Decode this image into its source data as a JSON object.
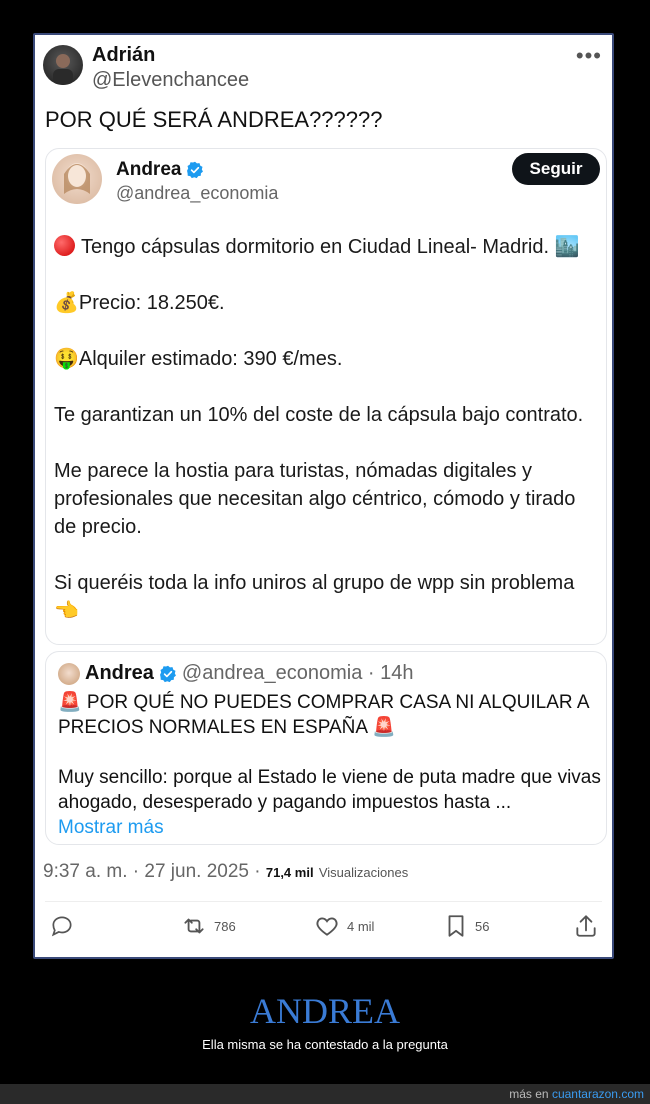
{
  "post": {
    "author_name": "Adrián",
    "author_handle": "@Elevenchancee",
    "more": "•••",
    "text": "POR QUÉ SERÁ ANDREA??????",
    "timestamp": "9:37 a. m. · 27 jun. 2025 ·",
    "views_count": "71,4 mil",
    "views_label": "Visualizaciones"
  },
  "quote": {
    "name": "Andrea",
    "handle": "@andrea_economia",
    "follow_label": "Seguir",
    "line1": "Tengo cápsulas dormitorio en Ciudad Lineal- Madrid. 🏙️",
    "line2": "💰Precio: 18.250€.",
    "line3": "🤑Alquiler estimado: 390 €/mes.",
    "line4": "Te garantizan un 10% del coste de la cápsula bajo contrato.",
    "line5": "Me parece la hostia para turistas, nómadas digitales y profesionales que necesitan algo céntrico, cómodo y tirado de precio.",
    "line6": "Si queréis toda la info uniros al grupo de wpp sin problema 👈"
  },
  "nested_quote": {
    "name": "Andrea",
    "handle_time": "@andrea_economia · 14h",
    "headline": "🚨 POR QUÉ NO PUEDES COMPRAR CASA NI ALQUILAR A PRECIOS NORMALES EN ESPAÑA 🚨",
    "body": "Muy sencillo: porque al Estado le viene de puta madre que vivas ahogado, desesperado y pagando impuestos hasta ...",
    "more_label": "Mostrar más"
  },
  "actions": {
    "reply_count": "",
    "retweet_count": "786",
    "like_count": "4 mil",
    "bookmark_count": "56"
  },
  "caption": {
    "title": "ANDREA",
    "subtitle": "Ella misma se ha contestado a la pregunta"
  },
  "footer": {
    "prefix": "más en",
    "site": "cuantarazon.com"
  },
  "colors": {
    "accent": "#1d9bf0",
    "verified": "#1d9bf0",
    "caption_title": "#3a7bd5"
  }
}
